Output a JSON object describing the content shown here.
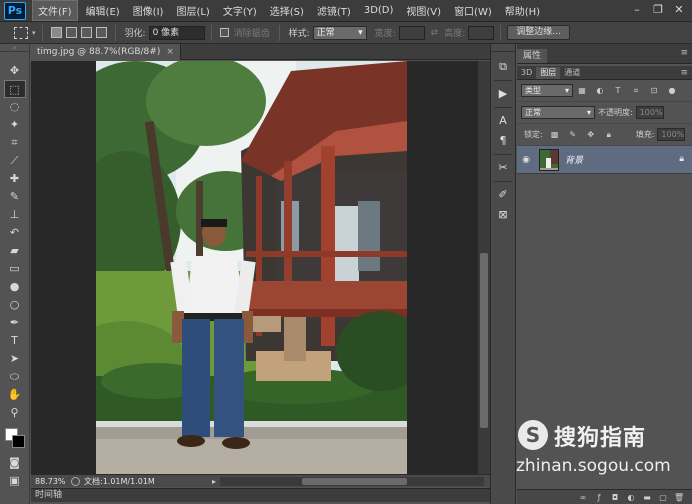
{
  "app": {
    "logo": "Ps"
  },
  "menu": {
    "items": [
      "文件(F)",
      "编辑(E)",
      "图像(I)",
      "图层(L)",
      "文字(Y)",
      "选择(S)",
      "滤镜(T)",
      "3D(D)",
      "视图(V)",
      "窗口(W)",
      "帮助(H)"
    ]
  },
  "window_controls": {
    "minimize": "–",
    "restore": "❐",
    "close": "✕"
  },
  "options": {
    "feather_label": "羽化:",
    "feather_value": "0 像素",
    "antialias_label": "消除锯齿",
    "style_label": "样式:",
    "style_value": "正常",
    "width_label": "宽度:",
    "height_label": "高度:",
    "refine_button": "调整边缘..."
  },
  "document": {
    "tab_title": "timg.jpg @ 88.7%(RGB/8#)",
    "tab_close": "×",
    "zoom": "88.73%",
    "doc_info": "文档:1.01M/1.01M",
    "timeline_label": "时间轴"
  },
  "panels": {
    "properties_tab": "属性",
    "menu_glyph": "≡",
    "layers_tabs": [
      "3D",
      "图层",
      "通道"
    ],
    "kind_value": "类型",
    "blend_mode": "正常",
    "opacity_label": "不透明度:",
    "opacity_value": "100%",
    "lock_label": "锁定:",
    "fill_label": "填充:",
    "fill_value": "100%",
    "layer_name": "背景"
  },
  "watermark": {
    "logo_letter": "S",
    "title": "搜狗指南",
    "url": "zhinan.sogou.com"
  },
  "colors": {
    "foreground": "#ffffff",
    "background": "#000000",
    "layer_selected": "#5f6b80"
  }
}
